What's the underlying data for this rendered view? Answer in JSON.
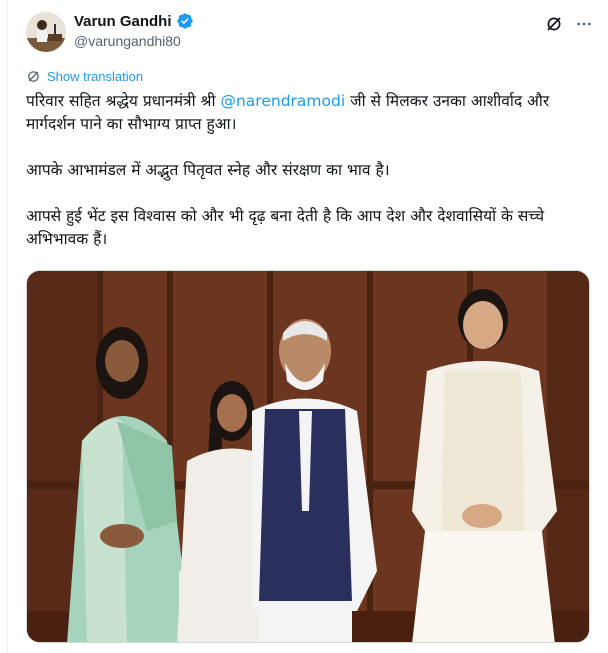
{
  "author": {
    "display_name": "Varun Gandhi",
    "handle": "@varungandhi80",
    "verified_color": "#1d9bf0"
  },
  "actions": {
    "grok_icon": "grok-icon",
    "more_icon": "more-icon"
  },
  "translate": {
    "label": "Show translation",
    "icon": "translate-icon"
  },
  "tweet": {
    "line1_before": "परिवार सहित श्रद्धेय प्रधानमंत्री श्री ",
    "mention": "@narendramodi",
    "line1_after": " जी से मिलकर उनका आशीर्वाद और मार्गदर्शन पाने का सौभाग्य प्राप्त हुआ।",
    "paragraph2": "आपके आभामंडल में अद्भुत पितृवत स्नेह और संरक्षण का भाव है।",
    "paragraph3": "आपसे हुई भेंट इस विश्वास को और भी दृढ़ बना देती है कि आप देश और देशवासियों के सच्चे अभिभावक हैं।"
  },
  "colors": {
    "link": "#1d9bf0",
    "text": "#0f1419",
    "secondary": "#536471"
  }
}
